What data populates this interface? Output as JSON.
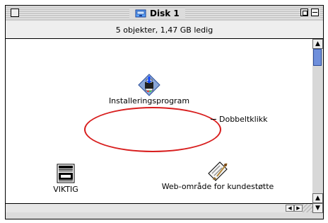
{
  "window": {
    "title": "Disk 1",
    "status": "5 objekter, 1,47 GB ledig"
  },
  "items": [
    {
      "label": "Installeringsprogram",
      "icon": "installer-icon"
    },
    {
      "label": "VIKTIG",
      "icon": "document-icon"
    },
    {
      "label": "Web-område for kundestøtte",
      "icon": "web-link-icon"
    }
  ],
  "annotation": {
    "hint": "Dobbeltklikk",
    "highlight_color": "#d81e1e"
  },
  "colors": {
    "scroll_thumb": "#6f8fdb"
  }
}
